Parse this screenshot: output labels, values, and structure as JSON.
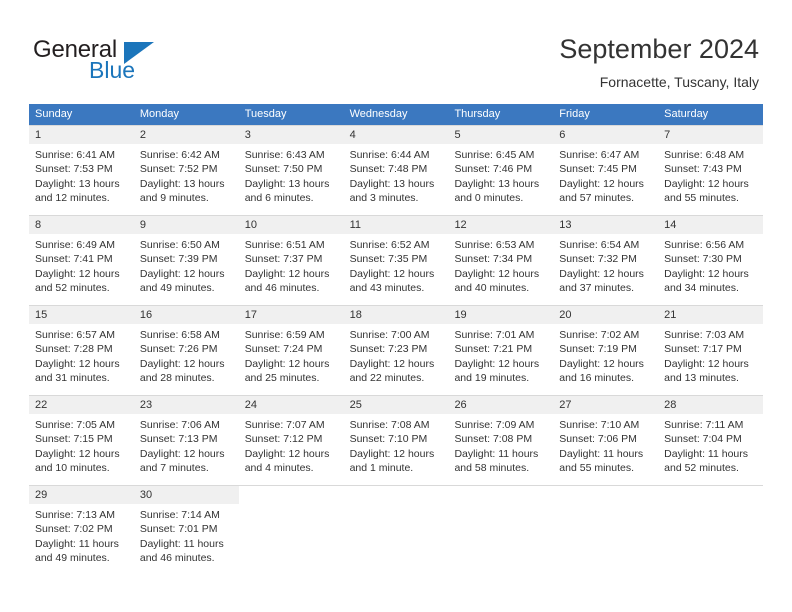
{
  "brand": {
    "name_part1": "General",
    "name_part2": "Blue"
  },
  "header": {
    "title": "September 2024",
    "subtitle": "Fornacette, Tuscany, Italy"
  },
  "colors": {
    "header_blue": "#3b78c0",
    "brand_blue": "#1b75bb",
    "daynum_band": "#f0f0f0",
    "text": "#333333",
    "row_divider": "#d9d9d9"
  },
  "weekdays": [
    "Sunday",
    "Monday",
    "Tuesday",
    "Wednesday",
    "Thursday",
    "Friday",
    "Saturday"
  ],
  "weeks": [
    [
      {
        "day": "1",
        "sunrise": "Sunrise: 6:41 AM",
        "sunset": "Sunset: 7:53 PM",
        "daylight1": "Daylight: 13 hours",
        "daylight2": "and 12 minutes."
      },
      {
        "day": "2",
        "sunrise": "Sunrise: 6:42 AM",
        "sunset": "Sunset: 7:52 PM",
        "daylight1": "Daylight: 13 hours",
        "daylight2": "and 9 minutes."
      },
      {
        "day": "3",
        "sunrise": "Sunrise: 6:43 AM",
        "sunset": "Sunset: 7:50 PM",
        "daylight1": "Daylight: 13 hours",
        "daylight2": "and 6 minutes."
      },
      {
        "day": "4",
        "sunrise": "Sunrise: 6:44 AM",
        "sunset": "Sunset: 7:48 PM",
        "daylight1": "Daylight: 13 hours",
        "daylight2": "and 3 minutes."
      },
      {
        "day": "5",
        "sunrise": "Sunrise: 6:45 AM",
        "sunset": "Sunset: 7:46 PM",
        "daylight1": "Daylight: 13 hours",
        "daylight2": "and 0 minutes."
      },
      {
        "day": "6",
        "sunrise": "Sunrise: 6:47 AM",
        "sunset": "Sunset: 7:45 PM",
        "daylight1": "Daylight: 12 hours",
        "daylight2": "and 57 minutes."
      },
      {
        "day": "7",
        "sunrise": "Sunrise: 6:48 AM",
        "sunset": "Sunset: 7:43 PM",
        "daylight1": "Daylight: 12 hours",
        "daylight2": "and 55 minutes."
      }
    ],
    [
      {
        "day": "8",
        "sunrise": "Sunrise: 6:49 AM",
        "sunset": "Sunset: 7:41 PM",
        "daylight1": "Daylight: 12 hours",
        "daylight2": "and 52 minutes."
      },
      {
        "day": "9",
        "sunrise": "Sunrise: 6:50 AM",
        "sunset": "Sunset: 7:39 PM",
        "daylight1": "Daylight: 12 hours",
        "daylight2": "and 49 minutes."
      },
      {
        "day": "10",
        "sunrise": "Sunrise: 6:51 AM",
        "sunset": "Sunset: 7:37 PM",
        "daylight1": "Daylight: 12 hours",
        "daylight2": "and 46 minutes."
      },
      {
        "day": "11",
        "sunrise": "Sunrise: 6:52 AM",
        "sunset": "Sunset: 7:35 PM",
        "daylight1": "Daylight: 12 hours",
        "daylight2": "and 43 minutes."
      },
      {
        "day": "12",
        "sunrise": "Sunrise: 6:53 AM",
        "sunset": "Sunset: 7:34 PM",
        "daylight1": "Daylight: 12 hours",
        "daylight2": "and 40 minutes."
      },
      {
        "day": "13",
        "sunrise": "Sunrise: 6:54 AM",
        "sunset": "Sunset: 7:32 PM",
        "daylight1": "Daylight: 12 hours",
        "daylight2": "and 37 minutes."
      },
      {
        "day": "14",
        "sunrise": "Sunrise: 6:56 AM",
        "sunset": "Sunset: 7:30 PM",
        "daylight1": "Daylight: 12 hours",
        "daylight2": "and 34 minutes."
      }
    ],
    [
      {
        "day": "15",
        "sunrise": "Sunrise: 6:57 AM",
        "sunset": "Sunset: 7:28 PM",
        "daylight1": "Daylight: 12 hours",
        "daylight2": "and 31 minutes."
      },
      {
        "day": "16",
        "sunrise": "Sunrise: 6:58 AM",
        "sunset": "Sunset: 7:26 PM",
        "daylight1": "Daylight: 12 hours",
        "daylight2": "and 28 minutes."
      },
      {
        "day": "17",
        "sunrise": "Sunrise: 6:59 AM",
        "sunset": "Sunset: 7:24 PM",
        "daylight1": "Daylight: 12 hours",
        "daylight2": "and 25 minutes."
      },
      {
        "day": "18",
        "sunrise": "Sunrise: 7:00 AM",
        "sunset": "Sunset: 7:23 PM",
        "daylight1": "Daylight: 12 hours",
        "daylight2": "and 22 minutes."
      },
      {
        "day": "19",
        "sunrise": "Sunrise: 7:01 AM",
        "sunset": "Sunset: 7:21 PM",
        "daylight1": "Daylight: 12 hours",
        "daylight2": "and 19 minutes."
      },
      {
        "day": "20",
        "sunrise": "Sunrise: 7:02 AM",
        "sunset": "Sunset: 7:19 PM",
        "daylight1": "Daylight: 12 hours",
        "daylight2": "and 16 minutes."
      },
      {
        "day": "21",
        "sunrise": "Sunrise: 7:03 AM",
        "sunset": "Sunset: 7:17 PM",
        "daylight1": "Daylight: 12 hours",
        "daylight2": "and 13 minutes."
      }
    ],
    [
      {
        "day": "22",
        "sunrise": "Sunrise: 7:05 AM",
        "sunset": "Sunset: 7:15 PM",
        "daylight1": "Daylight: 12 hours",
        "daylight2": "and 10 minutes."
      },
      {
        "day": "23",
        "sunrise": "Sunrise: 7:06 AM",
        "sunset": "Sunset: 7:13 PM",
        "daylight1": "Daylight: 12 hours",
        "daylight2": "and 7 minutes."
      },
      {
        "day": "24",
        "sunrise": "Sunrise: 7:07 AM",
        "sunset": "Sunset: 7:12 PM",
        "daylight1": "Daylight: 12 hours",
        "daylight2": "and 4 minutes."
      },
      {
        "day": "25",
        "sunrise": "Sunrise: 7:08 AM",
        "sunset": "Sunset: 7:10 PM",
        "daylight1": "Daylight: 12 hours",
        "daylight2": "and 1 minute."
      },
      {
        "day": "26",
        "sunrise": "Sunrise: 7:09 AM",
        "sunset": "Sunset: 7:08 PM",
        "daylight1": "Daylight: 11 hours",
        "daylight2": "and 58 minutes."
      },
      {
        "day": "27",
        "sunrise": "Sunrise: 7:10 AM",
        "sunset": "Sunset: 7:06 PM",
        "daylight1": "Daylight: 11 hours",
        "daylight2": "and 55 minutes."
      },
      {
        "day": "28",
        "sunrise": "Sunrise: 7:11 AM",
        "sunset": "Sunset: 7:04 PM",
        "daylight1": "Daylight: 11 hours",
        "daylight2": "and 52 minutes."
      }
    ],
    [
      {
        "day": "29",
        "sunrise": "Sunrise: 7:13 AM",
        "sunset": "Sunset: 7:02 PM",
        "daylight1": "Daylight: 11 hours",
        "daylight2": "and 49 minutes."
      },
      {
        "day": "30",
        "sunrise": "Sunrise: 7:14 AM",
        "sunset": "Sunset: 7:01 PM",
        "daylight1": "Daylight: 11 hours",
        "daylight2": "and 46 minutes."
      },
      {
        "day": "",
        "sunrise": "",
        "sunset": "",
        "daylight1": "",
        "daylight2": ""
      },
      {
        "day": "",
        "sunrise": "",
        "sunset": "",
        "daylight1": "",
        "daylight2": ""
      },
      {
        "day": "",
        "sunrise": "",
        "sunset": "",
        "daylight1": "",
        "daylight2": ""
      },
      {
        "day": "",
        "sunrise": "",
        "sunset": "",
        "daylight1": "",
        "daylight2": ""
      },
      {
        "day": "",
        "sunrise": "",
        "sunset": "",
        "daylight1": "",
        "daylight2": ""
      }
    ]
  ]
}
